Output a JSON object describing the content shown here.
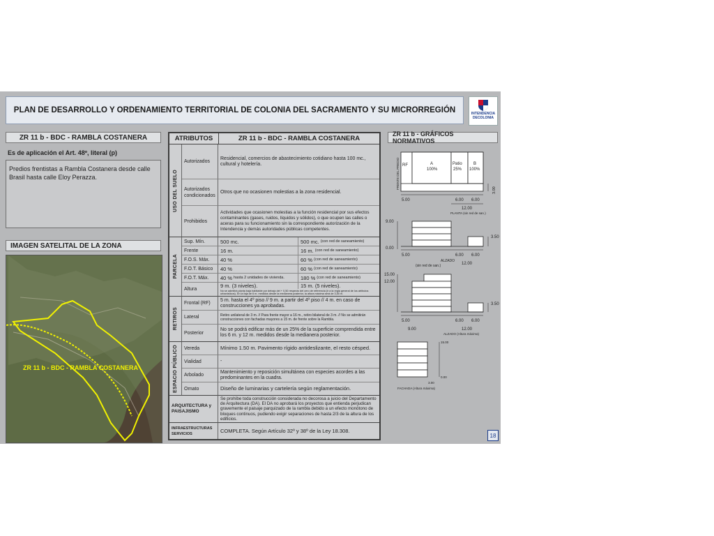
{
  "header": {
    "title": "PLAN DE DESARROLLO Y ORDENAMIENTO TERRITORIAL DE COLONIA DEL SACRAMENTO Y SU MICRORREGIÓN",
    "logo_text1": "INTENDENCIA",
    "logo_text2": "DE",
    "logo_text3": "COLONIA"
  },
  "left": {
    "zone_title": "ZR 11 b - BDC - RAMBLA COSTANERA",
    "application": "Es de aplicación el Art. 48º, literal (p)",
    "description": "Predios frentistas a Rambla Costanera desde calle Brasil hasta calle Eloy Perazza.",
    "satellite_title": "IMAGEN SATELITAL DE LA ZONA",
    "map_label": "ZR 11 b - BDC - RAMBLA COSTANERA"
  },
  "table": {
    "col1": "ATRIBUTOS",
    "col2": "ZR 11 b - BDC - RAMBLA COSTANERA",
    "uso": {
      "group": "USO DEL SUELO",
      "rows": [
        {
          "label": "Autorizados",
          "value": "Residencial, comercios de abastecimiento cotidiano hasta 100 mc., cultural y hotelería."
        },
        {
          "label": "Autorizados condicionados",
          "value": "Otros que no ocasionen molestias a la zona residencial."
        },
        {
          "label": "Prohibidos",
          "value": "Actividades que ocasionen molestias a la función residencial por sus efectos contaminantes (gases, ruidos, líquidos y sólidos), o que ocupen las calles o aceras para su funcionamiento sin la correspondiente autorización de la Intendencia y demás autoridades públicas competentes."
        }
      ]
    },
    "parcela": {
      "group": "PARCELA",
      "rows": [
        {
          "label": "Sup. Mín.",
          "a": "500 mc.",
          "a_note": "",
          "b": "500 mc.",
          "b_note": "(con red de saneamiento)"
        },
        {
          "label": "Frente",
          "a": "16 m.",
          "a_note": "",
          "b": "16 m.",
          "b_note": "(con red de saneamiento)"
        },
        {
          "label": "F.O.S. Máx.",
          "a": "40 %",
          "a_note": "",
          "b": "60 %",
          "b_note": "(con red de saneamiento)"
        },
        {
          "label": "F.O.T. Básico",
          "a": "40 %",
          "a_note": "",
          "b": "60 %",
          "b_note": "(con red de saneamiento)"
        },
        {
          "label": "F.O.T. Máx.",
          "a": "40 %",
          "a_note": "hasta 2 unidades de vivienda.",
          "b": "180 %",
          "b_note": "(con red de saneamiento)"
        }
      ],
      "altura_label": "Altura",
      "altura_a": "9 m. (3 niveles).",
      "altura_b": "15 m. (5 niveles).",
      "altura_note": "No se admitirá planta baja habitable por debajo del + 0,50 respecto del cero de referencia (ir a la regla general de los atributos urbanísticos). En la faja de 6 m. medidos desde la medianera posterior, la altura máxima será de 3,50 m."
    },
    "retiros": {
      "group": "RETIROS",
      "rows": [
        {
          "label": "Frontal (RF)",
          "value": "5 m. hasta el 4º piso // 9 m. a partir del 4º piso // 4 m. en caso de construcciones ya aprobadas."
        },
        {
          "label": "Lateral",
          "value": "Retiro unilateral de 3 m. // Para frente mayor a 16 m., retiro bilateral de 3 m. // No se admitirán construcciones con fachadas mayores a 15 m. de frente sobre la Rambla."
        },
        {
          "label": "Posterior",
          "value": "No se podrá edificar más de un 25% de la superficie comprendida entre los 6 m. y 12 m. medidos desde la medianera posterior."
        }
      ]
    },
    "espacio": {
      "group": "ESPACIO PÚBLICO",
      "rows": [
        {
          "label": "Vereda",
          "value": "Mínimo 1.50 m. Pavimento rígido antideslizante, el resto césped."
        },
        {
          "label": "Vialidad",
          "value": "-"
        },
        {
          "label": "Arbolado",
          "value": "Mantenimiento y reposición simultánea con especies acordes a las predominantes en la cuadra."
        },
        {
          "label": "Ornato",
          "value": "Diseño de luminarias y cartelería según reglamentación."
        }
      ]
    },
    "arq": {
      "label": "ARQUITECTURA y PAISAJISMO",
      "value": "Se prohíbe toda construcción considerada no decorosa a juicio del Departamento de Arquitectura (DA). El DA no aprobará los proyectos que entienda perjudican gravemente el paisaje parquizado de la rambla debido a un efecto monótono de bloques continuos, pudiendo exigir separaciones de hasta 2/3 de la altura de los edificios."
    },
    "infra": {
      "label": "INFRAESTRUCTURAS SERVICIOS",
      "value": "COMPLETA. Según Artículo 32º y 38º de la Ley 18.308."
    }
  },
  "graphics": {
    "title": "ZR 11 b - GRÁFICOS NORMATIVOS",
    "planta": {
      "frente": "FRENTE DEL PREDIO",
      "rf": "RF",
      "a": "A",
      "a_pct": "100%",
      "patio": "Patio",
      "patio_pct": "25%",
      "b": "B",
      "b_pct": "100%",
      "d1": "5.00",
      "d2": "6.00",
      "d3": "6.00",
      "d4": "12.00",
      "side": "3.00",
      "caption": "PLANTA (sin red de san.)"
    },
    "alzado1": {
      "h1": "9.00",
      "h0": "0.00",
      "h2": "3.50",
      "d1": "5.00",
      "d2": "6.00",
      "d3": "6.00",
      "d4": "12.00",
      "caption1": "ALZADO",
      "caption2": "(sin red de san.)"
    },
    "alzado2": {
      "h1": "15.00",
      "h2": "12.00",
      "h3": "3.50",
      "d1": "5.00",
      "d2": "9.00",
      "d3": "6.00",
      "d4": "6.00",
      "d5": "12.00",
      "caption": "ALZADO (Altura máxima)"
    },
    "fachada": {
      "h1": "15.00",
      "h0": "0.00",
      "w": "3.00",
      "caption": "FACHADA (Altura máxima)"
    }
  },
  "page_number": "18",
  "colors": {
    "slide_bg": "#b7b8ba",
    "header_bg": "#e6eaf0",
    "map_outline": "#f2f200",
    "brand": "#1b3b8a"
  }
}
